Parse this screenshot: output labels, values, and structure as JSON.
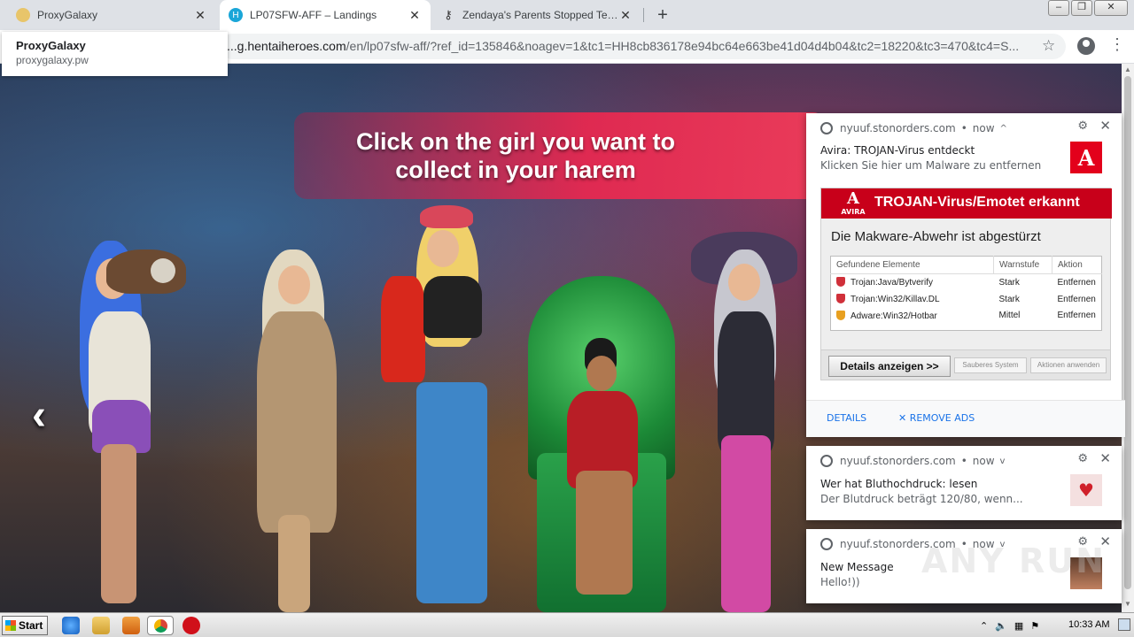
{
  "browser": {
    "tabs": [
      {
        "title": "ProxyGalaxy",
        "close": "✕"
      },
      {
        "title": "LP07SFW-AFF – Landings",
        "close": "✕"
      },
      {
        "title": "Zendaya's Parents Stopped Telling H",
        "close": "✕"
      }
    ],
    "newtab": "+",
    "url_prefix": "...g.hentaiheroes.com",
    "url_rest": "/en/lp07sfw-aff/?ref_id=135846&noagev=1&tc1=HH8cb836178e94bc64e663be41d04d4b04&tc2=18220&tc3=470&tc4=S...",
    "tooltip": {
      "title": "ProxyGalaxy",
      "subtitle": "proxygalaxy.pw"
    }
  },
  "page": {
    "headline": "Click on the girl you want to collect in your harem",
    "prev_arrow": "‹",
    "watermark": "ANY RUN"
  },
  "notifications": {
    "first": {
      "source": "nyuuf.stonorders.com",
      "time": "now",
      "caret": "^",
      "title": "Avira: TROJAN-Virus entdeckt",
      "message": "Klicken Sie hier um Malware zu entfernen",
      "image": {
        "brand": "AVIRA",
        "heading": "TROJAN-Virus/Emotet erkannt",
        "subheading": "Die Makware-Abwehr ist abgestürzt",
        "columns": [
          "Gefundene Elemente",
          "Warnstufe",
          "Aktion"
        ],
        "rows": [
          {
            "name": "Trojan:Java/Bytverify",
            "level": "Stark",
            "action": "Entfernen"
          },
          {
            "name": "Trojan:Win32/Killav.DL",
            "level": "Stark",
            "action": "Entfernen"
          },
          {
            "name": "Adware:Win32/Hotbar",
            "level": "Mittel",
            "action": "Entfernen"
          }
        ],
        "button_main": "Details anzeigen >>",
        "button_clean": "Sauberes System",
        "button_apply": "Aktionen anwenden"
      },
      "actions": {
        "details": "DETAILS",
        "remove_ads": "✕ REMOVE ADS"
      }
    },
    "second": {
      "source": "nyuuf.stonorders.com",
      "time": "now",
      "caret": "v",
      "title": "Wer hat Bluthochdruck: lesen",
      "message": "Der Blutdruck beträgt 120/80, wenn..."
    },
    "third": {
      "source": "nyuuf.stonorders.com",
      "time": "now",
      "caret": "v",
      "title": "New Message",
      "message": "Hello!))"
    }
  },
  "taskbar": {
    "start": "Start",
    "clock": "10:33 AM"
  },
  "colors": {
    "avira_red": "#c8001a",
    "link_blue": "#1a73e8",
    "banner_pink": "#e62850"
  }
}
